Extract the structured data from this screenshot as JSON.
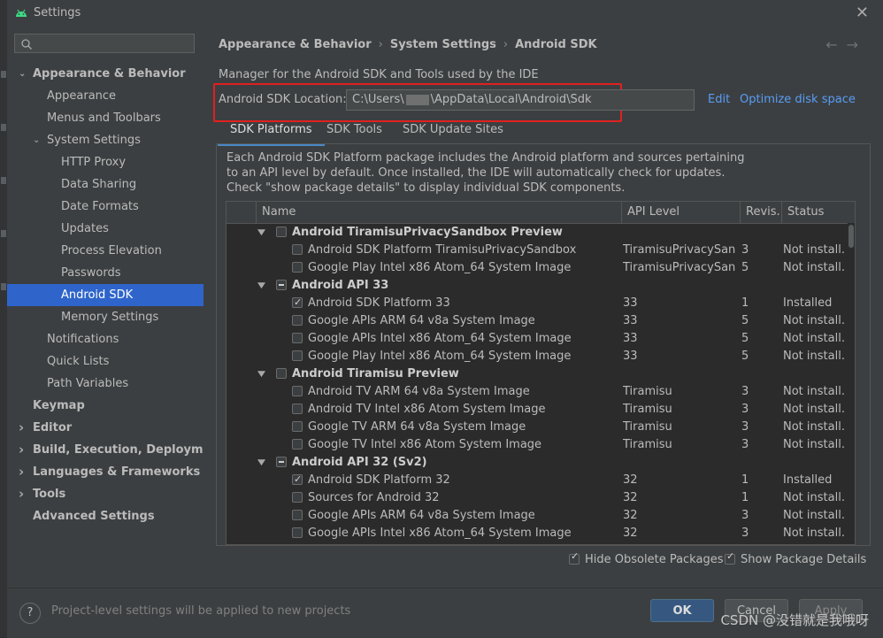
{
  "window": {
    "title": "Settings"
  },
  "sidebar": {
    "items": [
      {
        "label": "Appearance & Behavior",
        "level": 0,
        "expanded": true,
        "bold": true
      },
      {
        "label": "Appearance",
        "level": 1
      },
      {
        "label": "Menus and Toolbars",
        "level": 1
      },
      {
        "label": "System Settings",
        "level": 1,
        "expanded": true
      },
      {
        "label": "HTTP Proxy",
        "level": 2
      },
      {
        "label": "Data Sharing",
        "level": 2
      },
      {
        "label": "Date Formats",
        "level": 2
      },
      {
        "label": "Updates",
        "level": 2
      },
      {
        "label": "Process Elevation",
        "level": 2
      },
      {
        "label": "Passwords",
        "level": 2
      },
      {
        "label": "Android SDK",
        "level": 2,
        "selected": true
      },
      {
        "label": "Memory Settings",
        "level": 2
      },
      {
        "label": "Notifications",
        "level": 1
      },
      {
        "label": "Quick Lists",
        "level": 1
      },
      {
        "label": "Path Variables",
        "level": 1
      },
      {
        "label": "Keymap",
        "level": 0,
        "bold": true
      },
      {
        "label": "Editor",
        "level": 0,
        "collapsed": true,
        "bold": true
      },
      {
        "label": "Build, Execution, Deployment",
        "level": 0,
        "collapsed": true,
        "bold": true
      },
      {
        "label": "Languages & Frameworks",
        "level": 0,
        "collapsed": true,
        "bold": true
      },
      {
        "label": "Tools",
        "level": 0,
        "collapsed": true,
        "bold": true
      },
      {
        "label": "Advanced Settings",
        "level": 0,
        "bold": true
      }
    ]
  },
  "breadcrumb": [
    "Appearance & Behavior",
    "System Settings",
    "Android SDK"
  ],
  "main": {
    "description": "Manager for the Android SDK and Tools used by the IDE",
    "sdk_location_label": "Android SDK Location:",
    "sdk_location_prefix": "C:\\Users\\",
    "sdk_location_suffix": "\\AppData\\Local\\Android\\Sdk",
    "edit_link": "Edit",
    "optimize_link": "Optimize disk space",
    "tabs": [
      "SDK Platforms",
      "SDK Tools",
      "SDK Update Sites"
    ],
    "active_tab": 0,
    "panel_description": "Each Android SDK Platform package includes the Android platform and sources pertaining to an API level by default. Once installed, the IDE will automatically check for updates. Check \"show package details\" to display individual SDK components."
  },
  "table": {
    "columns": [
      "Name",
      "API Level",
      "Revis...",
      "Status"
    ],
    "rows": [
      {
        "group": true,
        "name": "Android TiramisuPrivacySandbox Preview",
        "check": "off"
      },
      {
        "name": "Android SDK Platform TiramisuPrivacySandbox",
        "api": "TiramisuPrivacySand...",
        "rev": "3",
        "status": "Not install...",
        "check": "off"
      },
      {
        "name": "Google Play Intel x86 Atom_64 System Image",
        "api": "TiramisuPrivacySand...",
        "rev": "5",
        "status": "Not install...",
        "check": "off"
      },
      {
        "group": true,
        "name": "Android API 33",
        "check": "part"
      },
      {
        "name": "Android SDK Platform 33",
        "api": "33",
        "rev": "1",
        "status": "Installed",
        "check": "on"
      },
      {
        "name": "Google APIs ARM 64 v8a System Image",
        "api": "33",
        "rev": "5",
        "status": "Not install...",
        "check": "off"
      },
      {
        "name": "Google APIs Intel x86 Atom_64 System Image",
        "api": "33",
        "rev": "5",
        "status": "Not install...",
        "check": "off"
      },
      {
        "name": "Google Play Intel x86 Atom_64 System Image",
        "api": "33",
        "rev": "5",
        "status": "Not install...",
        "check": "off"
      },
      {
        "group": true,
        "name": "Android Tiramisu Preview",
        "check": "off"
      },
      {
        "name": "Android TV ARM 64 v8a System Image",
        "api": "Tiramisu",
        "rev": "3",
        "status": "Not install...",
        "check": "off"
      },
      {
        "name": "Android TV Intel x86 Atom System Image",
        "api": "Tiramisu",
        "rev": "3",
        "status": "Not install...",
        "check": "off"
      },
      {
        "name": "Google TV ARM 64 v8a System Image",
        "api": "Tiramisu",
        "rev": "3",
        "status": "Not install...",
        "check": "off"
      },
      {
        "name": "Google TV Intel x86 Atom System Image",
        "api": "Tiramisu",
        "rev": "3",
        "status": "Not install...",
        "check": "off"
      },
      {
        "group": true,
        "name": "Android API 32 (Sv2)",
        "check": "part"
      },
      {
        "name": "Android SDK Platform 32",
        "api": "32",
        "rev": "1",
        "status": "Installed",
        "check": "on"
      },
      {
        "name": "Sources for Android 32",
        "api": "32",
        "rev": "1",
        "status": "Not install...",
        "check": "off"
      },
      {
        "name": "Google APIs ARM 64 v8a System Image",
        "api": "32",
        "rev": "3",
        "status": "Not install...",
        "check": "off"
      },
      {
        "name": "Google APIs Intel x86 Atom_64 System Image",
        "api": "32",
        "rev": "3",
        "status": "Not install...",
        "check": "off"
      }
    ]
  },
  "options": {
    "hide_obsolete": "Hide Obsolete Packages",
    "show_details": "Show Package Details"
  },
  "footer": {
    "help": "?",
    "note": "Project-level settings will be applied to new projects",
    "ok": "OK",
    "cancel": "Cancel",
    "apply": "Apply"
  },
  "watermark": "CSDN @没错就是我哦呀"
}
